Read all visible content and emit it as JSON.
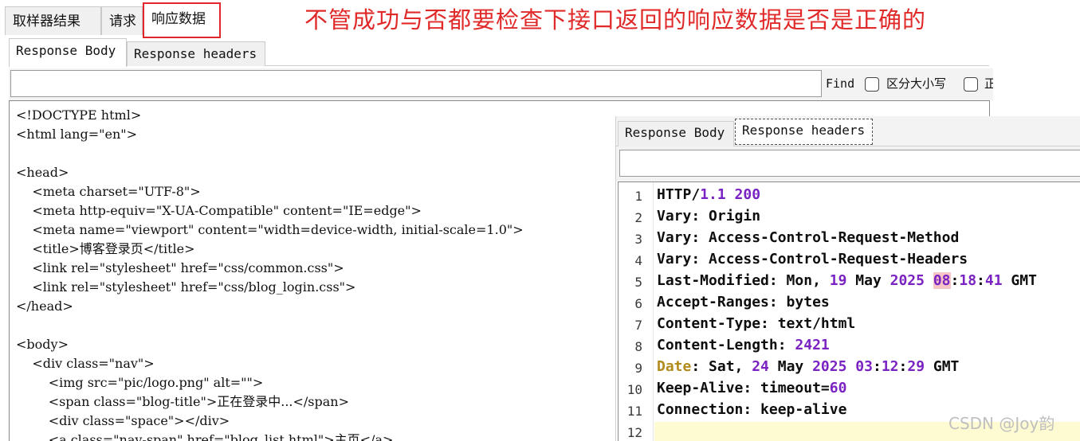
{
  "main_tabs": [
    "取样器结果",
    "请求",
    "响应数据"
  ],
  "annotation": "不管成功与否都要检查下接口返回的响应数据是否是正确的",
  "sub_tabs": [
    "Response Body",
    "Response headers"
  ],
  "find": {
    "label": "Find",
    "case_sensitive_label": "区分大小写",
    "regex_label_fragment": "正"
  },
  "body_lines": [
    "<!DOCTYPE html>",
    "<html lang=\"en\">",
    "",
    "<head>",
    "    <meta charset=\"UTF-8\">",
    "    <meta http-equiv=\"X-UA-Compatible\" content=\"IE=edge\">",
    "    <meta name=\"viewport\" content=\"width=device-width, initial-scale=1.0\">",
    "    <title>博客登录页</title>",
    "    <link rel=\"stylesheet\" href=\"css/common.css\">",
    "    <link rel=\"stylesheet\" href=\"css/blog_login.css\">",
    "</head>",
    "",
    "<body>",
    "    <div class=\"nav\">",
    "        <img src=\"pic/logo.png\" alt=\"\">",
    "        <span class=\"blog-title\">正在登录中...</span>",
    "        <div class=\"space\"></div>",
    "        <a class=\"nav-span\" href=\"blog_list.html\">主页</a>"
  ],
  "overlay": {
    "tabs": [
      "Response Body",
      "Response headers"
    ],
    "header_lines": [
      {
        "num": "1",
        "parts": [
          [
            "HTTP/",
            ""
          ],
          [
            "1.1 200",
            "num"
          ]
        ]
      },
      {
        "num": "2",
        "parts": [
          [
            "Vary: Origin",
            ""
          ]
        ]
      },
      {
        "num": "3",
        "parts": [
          [
            "Vary: Access-Control-Request-Method",
            ""
          ]
        ]
      },
      {
        "num": "4",
        "parts": [
          [
            "Vary: Access-Control-Request-Headers",
            ""
          ]
        ]
      },
      {
        "num": "5",
        "parts": [
          [
            "Last-Modified: Mon, ",
            ""
          ],
          [
            "19",
            "num"
          ],
          [
            " May ",
            ""
          ],
          [
            "2025",
            "num"
          ],
          [
            " ",
            ""
          ],
          [
            "08",
            "hl-num"
          ],
          [
            ":",
            ""
          ],
          [
            "18",
            "num"
          ],
          [
            ":",
            ""
          ],
          [
            "41",
            "num"
          ],
          [
            " GMT",
            ""
          ]
        ]
      },
      {
        "num": "6",
        "parts": [
          [
            "Accept-Ranges: bytes",
            ""
          ]
        ]
      },
      {
        "num": "7",
        "parts": [
          [
            "Content-Type: text/html",
            ""
          ]
        ]
      },
      {
        "num": "8",
        "parts": [
          [
            "Content-Length: ",
            ""
          ],
          [
            "2421",
            "num"
          ]
        ]
      },
      {
        "num": "9",
        "parts": [
          [
            "Date",
            "key-date"
          ],
          [
            ": Sat, ",
            ""
          ],
          [
            "24",
            "num"
          ],
          [
            " May ",
            ""
          ],
          [
            "2025",
            "num"
          ],
          [
            " ",
            ""
          ],
          [
            "03",
            "num"
          ],
          [
            ":",
            ""
          ],
          [
            "12",
            "num"
          ],
          [
            ":",
            ""
          ],
          [
            "29",
            "num"
          ],
          [
            " GMT",
            ""
          ]
        ]
      },
      {
        "num": "10",
        "parts": [
          [
            "Keep-Alive: timeout=",
            ""
          ],
          [
            "60",
            "num"
          ]
        ]
      },
      {
        "num": "11",
        "parts": [
          [
            "Connection: keep-alive",
            ""
          ]
        ]
      },
      {
        "num": "12",
        "parts": []
      }
    ]
  },
  "watermark": "CSDN @Joy韵"
}
